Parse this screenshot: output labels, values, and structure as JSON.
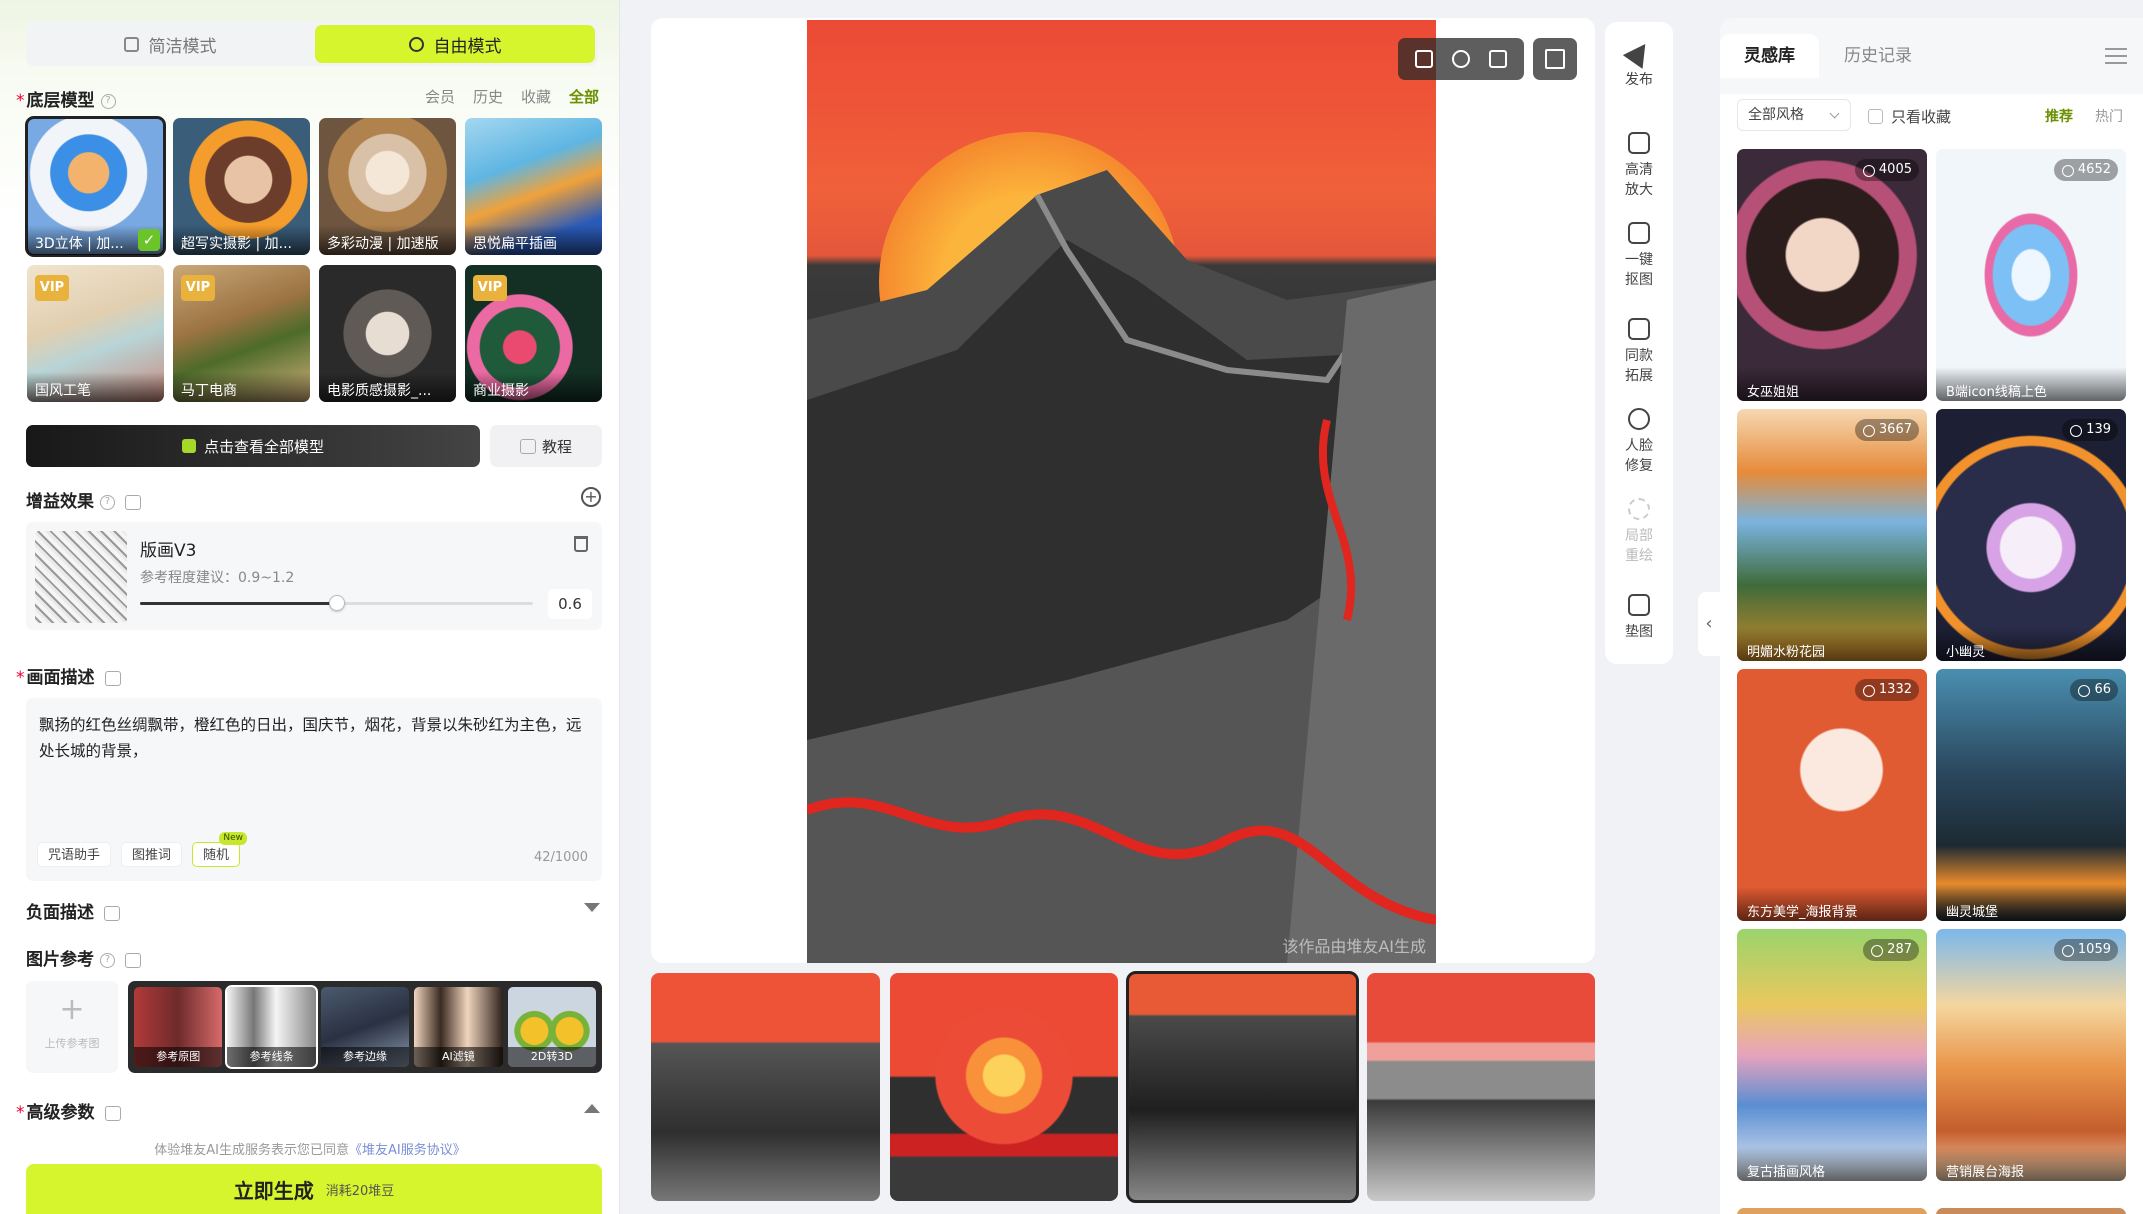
{
  "left": {
    "mode_simple": "简洁模式",
    "mode_free": "自由模式",
    "base_model": {
      "title": "底层模型",
      "filters": [
        "会员",
        "历史",
        "收藏",
        "全部"
      ],
      "models": [
        {
          "label": "3D立体 | 加...",
          "vip": false,
          "selected": true
        },
        {
          "label": "超写实摄影 | 加...",
          "vip": false,
          "selected": false
        },
        {
          "label": "多彩动漫 | 加速版",
          "vip": false,
          "selected": false
        },
        {
          "label": "思悦扁平插画",
          "vip": false,
          "selected": false
        },
        {
          "label": "国风工笔",
          "vip": true,
          "selected": false
        },
        {
          "label": "马丁电商",
          "vip": true,
          "selected": false
        },
        {
          "label": "电影质感摄影_...",
          "vip": false,
          "selected": false
        },
        {
          "label": "商业摄影",
          "vip": true,
          "selected": false
        }
      ],
      "vip_badge": "VIP",
      "view_all_button": "点击查看全部模型",
      "tutorial_button": "教程"
    },
    "effects": {
      "title": "增益效果",
      "name": "版画V3",
      "hint": "参考程度建议：0.9~1.2",
      "value_text": "0.6",
      "slider_fraction": 0.5
    },
    "description": {
      "title": "画面描述",
      "text": "飘扬的红色丝绸飘带，橙红色的日出，国庆节，烟花，背景以朱砂红为主色，远处长城的背景，",
      "chips": [
        "咒语助手",
        "图推词",
        "随机"
      ],
      "new_tag": "New",
      "count": "42/1000"
    },
    "negative": {
      "title": "负面描述"
    },
    "reference": {
      "title": "图片参考",
      "upload_label": "上传参考图",
      "items": [
        "参考原图",
        "参考线条",
        "参考边缘",
        "AI滤镜",
        "2D转3D"
      ]
    },
    "advanced": {
      "title": "高级参数"
    },
    "agreement_prefix": "体验堆友AI生成服务表示您已同意",
    "agreement_link": "《堆友AI服务协议》",
    "generate_label": "立即生成",
    "generate_cost": "消耗20堆豆"
  },
  "center": {
    "watermark": "该作品由堆友AI生成",
    "thumb_selected": 2
  },
  "tools": [
    "发布",
    "高清放大",
    "一键抠图",
    "同款拓展",
    "人脸修复",
    "局部重绘",
    "垫图"
  ],
  "right": {
    "tabs": [
      "灵感库",
      "历史记录"
    ],
    "style_select": "全部风格",
    "favorites_only": "只看收藏",
    "sort_recommend": "推荐",
    "sort_hot": "热门",
    "items": [
      {
        "label": "女巫姐姐",
        "count": "4005"
      },
      {
        "label": "B端icon线稿上色",
        "count": "4652"
      },
      {
        "label": "明媚水粉花园",
        "count": "3667"
      },
      {
        "label": "小幽灵",
        "count": "139"
      },
      {
        "label": "东方美学_海报背景",
        "count": "1332"
      },
      {
        "label": "幽灵城堡",
        "count": "66"
      },
      {
        "label": "复古插画风格",
        "count": "287"
      },
      {
        "label": "营销展台海报",
        "count": "1059"
      }
    ]
  },
  "colors": {
    "accent": "#d6f52c",
    "selected_filter": "#6b8f00"
  }
}
